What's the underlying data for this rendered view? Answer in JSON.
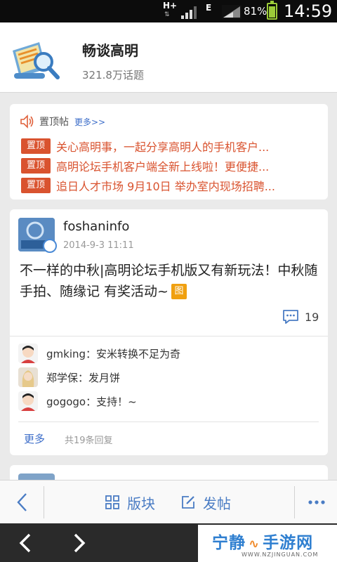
{
  "status_bar": {
    "network": "H+",
    "network2": "E",
    "battery": "81%",
    "time": "14:59"
  },
  "header": {
    "title": "畅谈高明",
    "topic_count": "321.8万话题"
  },
  "pinned": {
    "label": "置顶帖",
    "more": "更多>>",
    "badge": "置顶",
    "items": [
      "关心高明事，一起分享高明人的手机客户...",
      "高明论坛手机客户端全新上线啦！更便捷...",
      "追日人才市场 9月10日 举办室内现场招聘..."
    ]
  },
  "post": {
    "author": "foshaninfo",
    "time": "2014-9-3 11:11",
    "title": "不一样的中秋|高明论坛手机版又有新玩法！中秋随手拍、随缘记 有奖活动~",
    "image_tag": "图",
    "comment_count": "19",
    "replies": [
      {
        "text": "gmking：安米转换不足为奇"
      },
      {
        "text": "郑学保：发月饼"
      },
      {
        "text": "gogogo：支持！~"
      }
    ],
    "more": "更多",
    "total_replies": "共19条回复"
  },
  "toolbar": {
    "sections": "版块",
    "compose": "发帖"
  },
  "watermark": {
    "brand": "宁静",
    "brand2": "手游网",
    "url": "WWW.NZJINGUAN.COM"
  },
  "colors": {
    "accent": "#4a7cc4",
    "pin_red": "#d9532f",
    "image_tag": "#f0a010"
  }
}
